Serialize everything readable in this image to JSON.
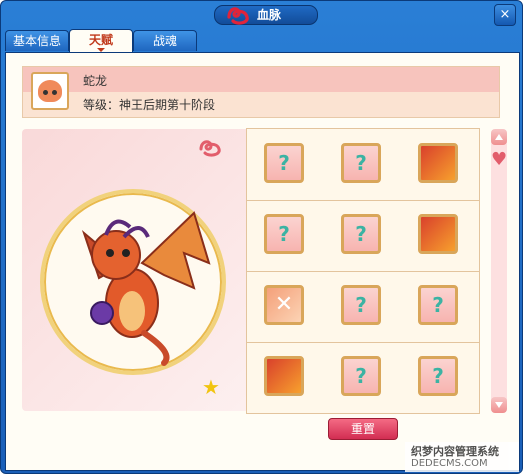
{
  "window": {
    "title": "血脉",
    "close": "×"
  },
  "tabs": [
    {
      "label": "基本信息"
    },
    {
      "label": "天赋"
    },
    {
      "label": "战魂"
    }
  ],
  "pet": {
    "name": "蛇龙",
    "level": "等级：神王后期第十阶段"
  },
  "slot_grid": {
    "rows": [
      [
        {
          "icon": "question-mark-icon"
        },
        {
          "icon": "question-mark-icon"
        },
        {
          "icon": "fire-feather-icon"
        }
      ],
      [
        {
          "icon": "question-mark-icon"
        },
        {
          "icon": "question-mark-icon"
        },
        {
          "icon": "fire-dragon-icon"
        }
      ],
      [
        {
          "icon": "cross-burst-icon"
        },
        {
          "icon": "question-mark-icon"
        },
        {
          "icon": "question-mark-icon"
        }
      ],
      [
        {
          "icon": "fire-wave-icon"
        },
        {
          "icon": "question-mark-icon"
        },
        {
          "icon": "question-mark-icon"
        }
      ]
    ],
    "question_glyph": "?"
  },
  "buttons": {
    "reset": "重置"
  },
  "watermark": {
    "line1": "织梦内容管理系统",
    "line2": "DEDECMS.COM"
  },
  "colors": {
    "accent": "#d22d52",
    "frame": "#1a5fb8",
    "gold": "#d9a65a"
  }
}
